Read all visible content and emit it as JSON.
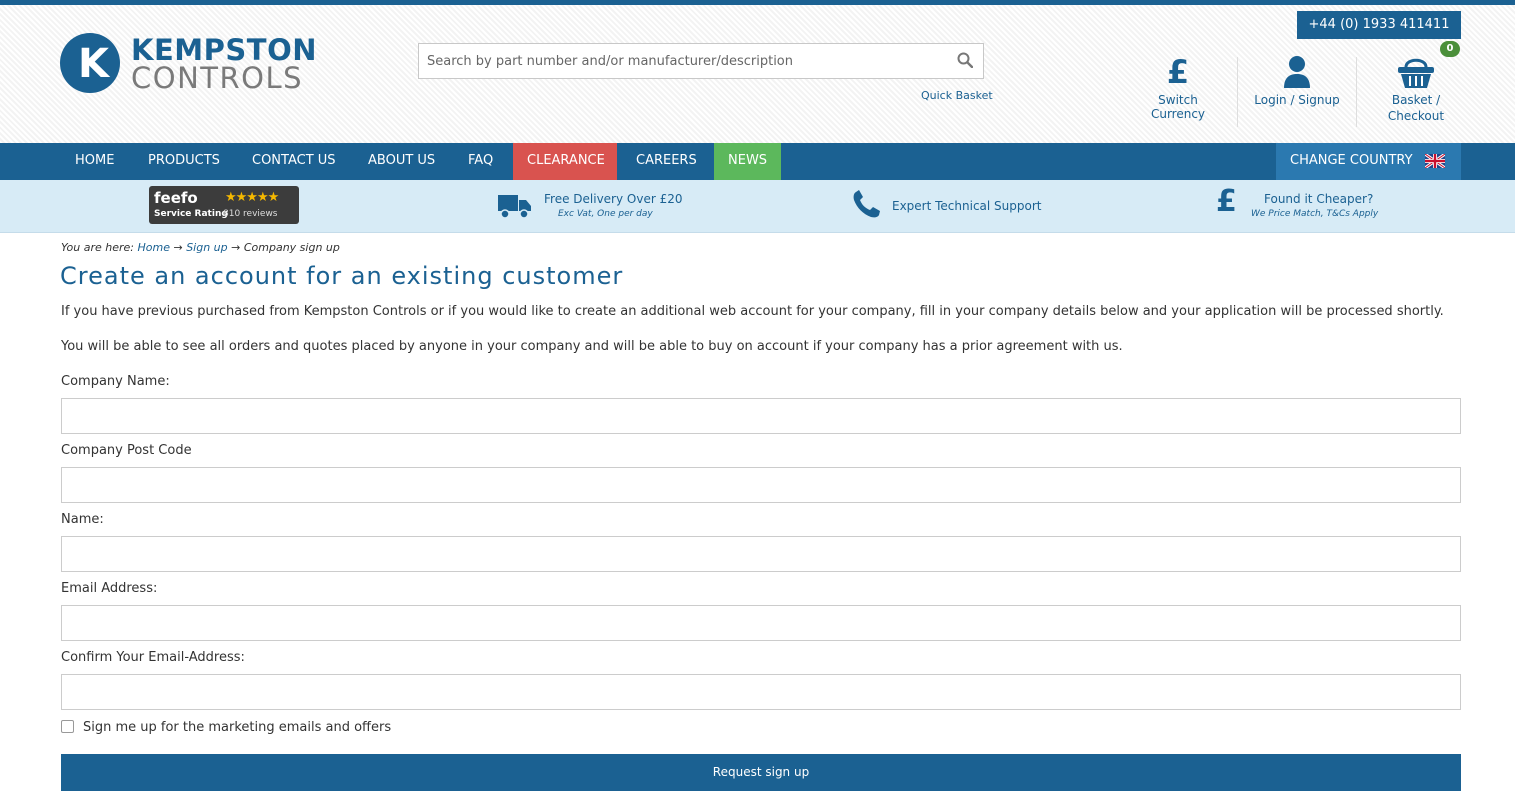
{
  "header": {
    "logo_line1": "KEMPSTON",
    "logo_line2": "CONTROLS",
    "phone": "+44 (0) 1933 411411",
    "search_placeholder": "Search by part number and/or manufacturer/description",
    "quick_basket": "Quick Basket",
    "switch_currency": "Switch Currency",
    "login_signup": "Login / Signup",
    "basket_line1": "Basket /",
    "basket_line2": "Checkout",
    "basket_count": "0",
    "currency_symbol": "£"
  },
  "nav": {
    "items": [
      "HOME",
      "PRODUCTS",
      "CONTACT US",
      "ABOUT US",
      "FAQ",
      "CLEARANCE",
      "CAREERS",
      "NEWS"
    ],
    "change_country": "CHANGE COUNTRY"
  },
  "usp": {
    "feefo_logo": "feefo",
    "feefo_stars": "★★★★★",
    "feefo_rating_label": "Service Rating",
    "feefo_reviews": "810 reviews",
    "delivery_title": "Free Delivery Over £20",
    "delivery_sub": "Exc Vat, One per day",
    "support_title": "Expert Technical Support",
    "cheaper_title": "Found it Cheaper?",
    "cheaper_sub": "We Price Match, T&Cs Apply"
  },
  "breadcrumb": {
    "prefix": "You are here:",
    "home": "Home",
    "arrow": "→",
    "signup": "Sign up",
    "current": "Company sign up"
  },
  "page": {
    "title": "Create an account for an existing customer",
    "intro1": "If you have previous purchased from Kempston Controls or if you would like to create an additional web account for your company, fill in your company details below and your application will be processed shortly.",
    "intro2": "You will be able to see all orders and quotes placed by anyone in your company and will be able to buy on account if your company has a prior agreement with us."
  },
  "form": {
    "company_name": "Company Name:",
    "post_code": "Company Post Code",
    "name": "Name:",
    "email": "Email Address:",
    "confirm_email": "Confirm Your Email-Address:",
    "marketing": "Sign me up for the marketing emails and offers",
    "submit": "Request sign up"
  },
  "colors": {
    "brand_blue": "#1b6192",
    "clearance_red": "#d9534f",
    "news_green": "#5cb85c",
    "usp_bar": "#d7ebf6"
  }
}
